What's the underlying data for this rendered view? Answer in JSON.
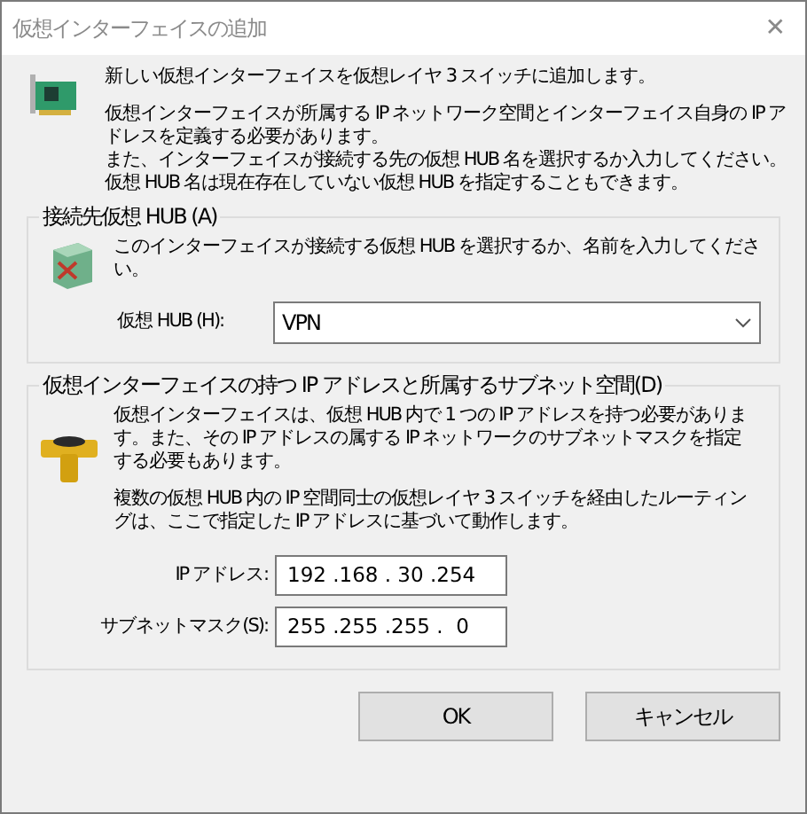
{
  "window": {
    "title": "仮想インターフェイスの追加",
    "close": "✕"
  },
  "intro": {
    "heading": "新しい仮想インターフェイスを仮想レイヤ 3 スイッチに追加します。",
    "lines": [
      "仮想インターフェイスが所属する IP ネットワーク空間とインターフェイス自身の IP アドレスを定義する必要があります。",
      "また、インターフェイスが接続する先の仮想 HUB 名を選択するか入力してください。",
      "仮想 HUB 名は現在存在していない仮想 HUB を指定することもできます。"
    ]
  },
  "hub_group": {
    "title": "接続先仮想 HUB (A)",
    "description": "このインターフェイスが接続する仮想 HUB を選択するか、名前を入力してください。",
    "field_label": "仮想 HUB (H):",
    "value": "VPN"
  },
  "ip_group": {
    "title": "仮想インターフェイスの持つ IP アドレスと所属するサブネット空間(D)",
    "paragraphs": [
      "仮想インターフェイスは、仮想 HUB 内で 1 つの IP アドレスを持つ必要があります。また、その IP アドレスの属する IP ネットワークのサブネットマスクを指定する必要もあります。",
      "複数の仮想 HUB 内の IP 空間同士の仮想レイヤ 3 スイッチを経由したルーティングは、ここで指定した IP アドレスに基づいて動作します。"
    ],
    "fields": [
      {
        "label": "IP アドレス:",
        "value": "192 .168 . 30 .254"
      },
      {
        "label": "サブネットマスク(S):",
        "value": "255 .255 .255 .  0"
      }
    ]
  },
  "buttons": [
    "OK",
    "キャンセル"
  ]
}
